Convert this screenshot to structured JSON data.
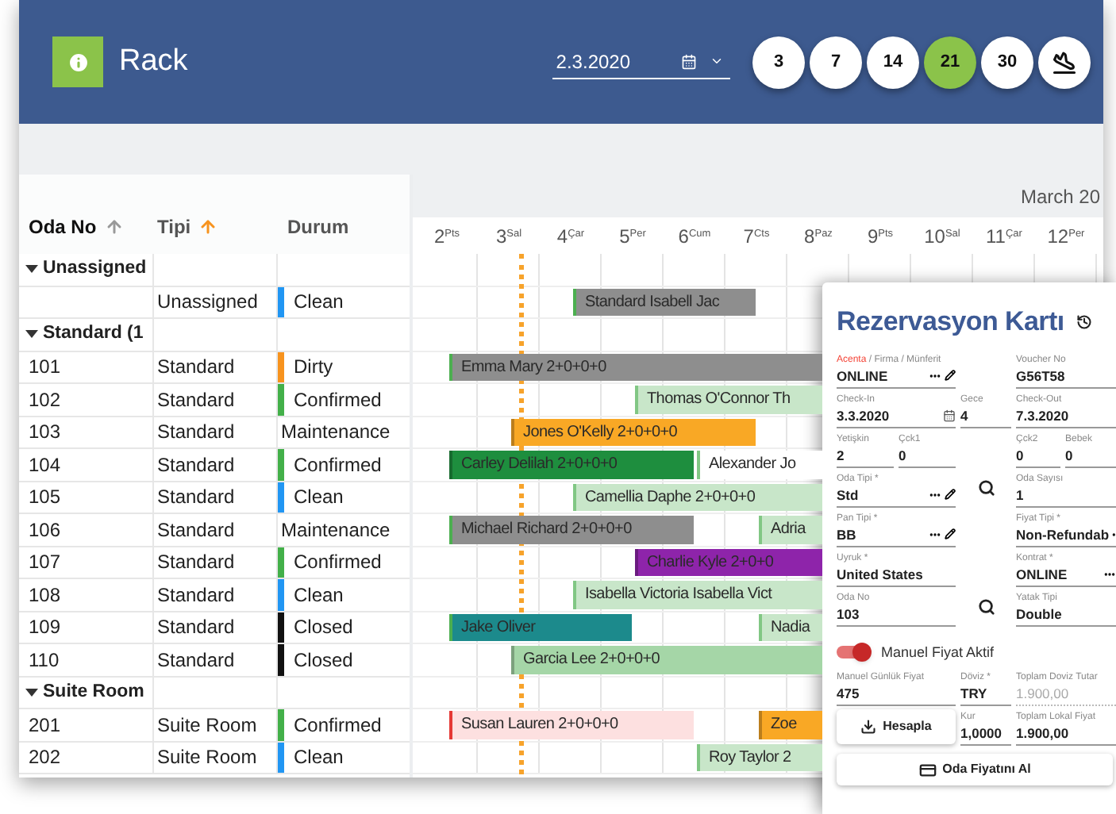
{
  "header": {
    "title": "Rack",
    "date": "2.3.2020",
    "ranges": [
      {
        "label": "3",
        "selected": false
      },
      {
        "label": "7",
        "selected": false
      },
      {
        "label": "14",
        "selected": false
      },
      {
        "label": "21",
        "selected": true
      },
      {
        "label": "30",
        "selected": false
      }
    ]
  },
  "columns": [
    {
      "label": "Oda No",
      "active": false
    },
    {
      "label": "Tipi",
      "active": true
    },
    {
      "label": "Durum"
    }
  ],
  "month": "March 20",
  "days": [
    {
      "day": "2",
      "weekday": "Pts"
    },
    {
      "day": "3",
      "weekday": "Sal"
    },
    {
      "day": "4",
      "weekday": "Çar"
    },
    {
      "day": "5",
      "weekday": "Per"
    },
    {
      "day": "6",
      "weekday": "Cum"
    },
    {
      "day": "7",
      "weekday": "Cts"
    },
    {
      "day": "8",
      "weekday": "Paz"
    },
    {
      "day": "9",
      "weekday": "Pts"
    },
    {
      "day": "10",
      "weekday": "Sal"
    },
    {
      "day": "11",
      "weekday": "Çar"
    },
    {
      "day": "12",
      "weekday": "Per"
    }
  ],
  "groups": [
    {
      "label": "Unassigned",
      "expanded": true,
      "rooms": [
        {
          "type": "Unassigned",
          "status": "Clean",
          "color": "#2196f3",
          "bars": [
            {
              "name": "Standard Isabell Jac",
              "color": "#8e8e8e"
            }
          ]
        }
      ]
    },
    {
      "label": "Standard (1",
      "expanded": true,
      "rooms": [
        {
          "no": "101",
          "type": "Standard",
          "status": "Dirty",
          "color": "#f7931e",
          "bars": [
            {
              "name": "Emma Mary 2+0+0+0",
              "color": "#8e8e8e"
            }
          ]
        },
        {
          "no": "102",
          "type": "Standard",
          "status": "Confirmed",
          "color": "#43b049",
          "bars": [
            {
              "name": "Thomas O'Connor Th",
              "color": "#c8e6c9"
            }
          ]
        },
        {
          "no": "103",
          "type": "Standard",
          "status": "Maintenance",
          "bars": [
            {
              "name": "Jones O'Kelly 2+0+0+0",
              "color": "#f9a825"
            }
          ]
        },
        {
          "no": "104",
          "type": "Standard",
          "status": "Confirmed",
          "color": "#43b049",
          "bars": [
            {
              "name": "Carley Delilah 2+0+0+0",
              "color": "#1e8e3e"
            },
            {
              "name": "Alexander Jo",
              "color": "#ffffff"
            }
          ]
        },
        {
          "no": "105",
          "type": "Standard",
          "status": "Clean",
          "color": "#2196f3",
          "bars": [
            {
              "name": "Camellia Daphe 2+0+0+0",
              "color": "#c8e6c9"
            }
          ]
        },
        {
          "no": "106",
          "type": "Standard",
          "status": "Maintenance",
          "bars": [
            {
              "name": "Michael Richard 2+0+0+0",
              "color": "#8e8e8e"
            },
            {
              "name": "Adria",
              "color": "#c8e6c9"
            }
          ]
        },
        {
          "no": "107",
          "type": "Standard",
          "status": "Confirmed",
          "color": "#43b049",
          "bars": [
            {
              "name": "Charlie Kyle 2+0+0",
              "color": "#8e24aa"
            }
          ]
        },
        {
          "no": "108",
          "type": "Standard",
          "status": "Clean",
          "color": "#2196f3",
          "bars": [
            {
              "name": "Isabella Victoria Isabella Vict",
              "color": "#c8e6c9"
            }
          ]
        },
        {
          "no": "109",
          "type": "Standard",
          "status": "Closed",
          "color": "#111111",
          "bars": [
            {
              "name": "Jake Oliver",
              "color": "#1c8a8c"
            },
            {
              "name": "Nadia",
              "color": "#c8e6c9"
            }
          ]
        },
        {
          "no": "110",
          "type": "Standard",
          "status": "Closed",
          "color": "#111111",
          "bars": [
            {
              "name": "Garcia Lee 2+0+0+0",
              "color": "#a5d6a7"
            }
          ]
        }
      ]
    },
    {
      "label": "Suite Room",
      "expanded": true,
      "rooms": [
        {
          "no": "201",
          "type": "Suite Room",
          "status": "Confirmed",
          "color": "#43b049",
          "bars": [
            {
              "name": "Susan Lauren 2+0+0+0",
              "color": "#fde0e0"
            },
            {
              "name": "Zoe",
              "color": "#f9a825"
            }
          ]
        },
        {
          "no": "202",
          "type": "Suite Room",
          "status": "Clean",
          "color": "#2196f3",
          "bars": [
            {
              "name": "Roy Taylor 2",
              "color": "#c8e6c9"
            }
          ]
        }
      ]
    }
  ],
  "card": {
    "title": "Rezervasyon Kartı",
    "fields": [
      {
        "label_accent": "Acenta",
        "label": "/ Firma / Münferit",
        "value": "ONLINE",
        "kind": "lookup",
        "disabled": false
      },
      {
        "label": "Voucher No",
        "value": "G56T58",
        "kind": "text",
        "disabled": false
      },
      {
        "label": "Check-In",
        "value": "3.3.2020",
        "kind": "date",
        "disabled": false
      },
      {
        "label": "Gece",
        "value": "4",
        "kind": "number",
        "disabled": false
      },
      {
        "label": "Check-Out",
        "value": "7.3.2020",
        "kind": "text",
        "disabled": false
      },
      {
        "label": "Yetişkin",
        "value": "2",
        "kind": "number",
        "disabled": false
      },
      {
        "label": "Çck1",
        "value": "0",
        "kind": "number",
        "disabled": false
      },
      {
        "label": "Çck2",
        "value": "0",
        "kind": "number",
        "disabled": false
      },
      {
        "label": "Bebek",
        "value": "0",
        "kind": "text",
        "disabled": false
      },
      {
        "label": "Oda Tipi *",
        "value": "Std",
        "kind": "lookup",
        "disabled": false
      },
      {
        "kind": "search"
      },
      {
        "label": "Oda Sayısı",
        "value": "1",
        "kind": "text",
        "disabled": false
      },
      {
        "label": "Pan Tipi *",
        "value": "BB",
        "kind": "lookup",
        "disabled": false
      },
      {
        "kind": "empty"
      },
      {
        "label": "Fiyat Tipi *",
        "value": "Non-Refundab",
        "kind": "select",
        "disabled": false
      },
      {
        "label": "Uyruk *",
        "value": "United States",
        "kind": "text",
        "disabled": false
      },
      {
        "kind": "empty"
      },
      {
        "label": "Kontrat *",
        "value": "ONLINE",
        "kind": "select",
        "disabled": false
      },
      {
        "label": "Oda No",
        "value": "103",
        "kind": "text",
        "disabled": false
      },
      {
        "kind": "search"
      },
      {
        "label": "Yatak Tipi",
        "value": "Double",
        "kind": "text",
        "disabled": false
      }
    ],
    "toggle": {
      "label": "Manuel Fiyat Aktif",
      "on": true
    },
    "price_fields": [
      {
        "label": "Manuel Günlük Fiyat",
        "value": "475",
        "kind": "number",
        "disabled": false
      },
      {
        "label": "Döviz *",
        "value": "TRY",
        "kind": "text",
        "disabled": false
      },
      {
        "label": "Toplam Doviz Tutar",
        "value": "1.900,00",
        "kind": "text",
        "disabled": true
      },
      {
        "label": "Hesapla",
        "kind": "button"
      },
      {
        "label": "Kur",
        "value": "1,0000",
        "kind": "text",
        "disabled": false
      },
      {
        "label": "Toplam Lokal Fiyat",
        "value": "1.900,00",
        "kind": "text",
        "disabled": false
      }
    ],
    "button": "Oda Fiyatını Al"
  }
}
